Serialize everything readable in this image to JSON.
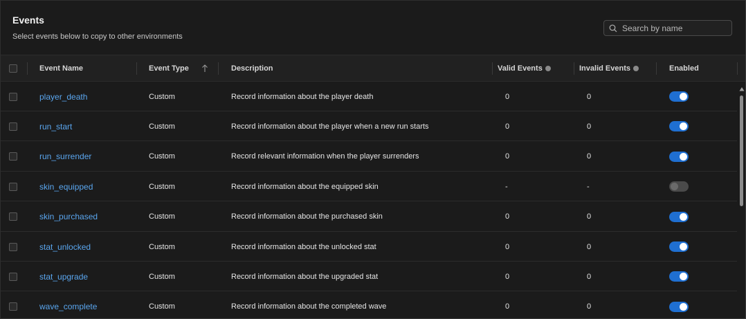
{
  "header": {
    "title": "Events",
    "subtitle": "Select events below to copy to other environments",
    "search_placeholder": "Search by name"
  },
  "columns": {
    "name": "Event Name",
    "type": "Event Type",
    "description": "Description",
    "valid": "Valid Events",
    "invalid": "Invalid Events",
    "enabled": "Enabled"
  },
  "colors": {
    "link": "#5aa6ef",
    "toggle_on": "#1f6fd1",
    "toggle_off": "#4a4a4a",
    "background": "#1b1b1b"
  },
  "rows": [
    {
      "name": "player_death",
      "type": "Custom",
      "description": "Record information about the player death",
      "valid": "0",
      "invalid": "0",
      "enabled": true
    },
    {
      "name": "run_start",
      "type": "Custom",
      "description": "Record information about the player when a new run starts",
      "valid": "0",
      "invalid": "0",
      "enabled": true
    },
    {
      "name": "run_surrender",
      "type": "Custom",
      "description": "Record relevant information when the player surrenders",
      "valid": "0",
      "invalid": "0",
      "enabled": true
    },
    {
      "name": "skin_equipped",
      "type": "Custom",
      "description": "Record information about the equipped skin",
      "valid": "-",
      "invalid": "-",
      "enabled": false
    },
    {
      "name": "skin_purchased",
      "type": "Custom",
      "description": "Record information about the purchased skin",
      "valid": "0",
      "invalid": "0",
      "enabled": true
    },
    {
      "name": "stat_unlocked",
      "type": "Custom",
      "description": "Record information about the unlocked stat",
      "valid": "0",
      "invalid": "0",
      "enabled": true
    },
    {
      "name": "stat_upgrade",
      "type": "Custom",
      "description": "Record information about the upgraded stat",
      "valid": "0",
      "invalid": "0",
      "enabled": true
    },
    {
      "name": "wave_complete",
      "type": "Custom",
      "description": "Record information about the completed wave",
      "valid": "0",
      "invalid": "0",
      "enabled": true
    }
  ]
}
